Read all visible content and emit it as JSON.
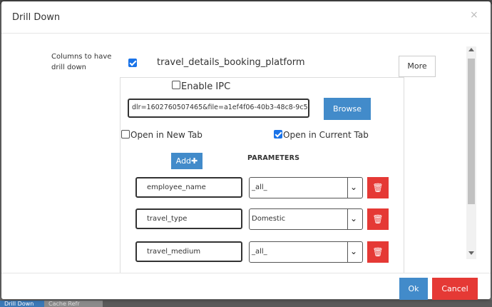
{
  "backdrop": {
    "tab_active": "Drill Down",
    "tab_second": "Cache Refr"
  },
  "modal": {
    "title": "Drill Down",
    "close_glyph": "×"
  },
  "drill": {
    "columns_label": "Columns to have drill down",
    "field_checked": true,
    "field_name": "travel_details_booking_platform",
    "more_label": "More"
  },
  "ipc": {
    "label": "Enable IPC",
    "checked": false
  },
  "url": {
    "value": "dlr=1602760507465&file=a1ef4f06-40b3-48c8-9c5"
  },
  "browse_label": "Browse",
  "open_options": {
    "new_tab_label": "Open in New Tab",
    "new_tab_checked": false,
    "current_tab_label": "Open in Current Tab",
    "current_tab_checked": true
  },
  "add_label": "Add",
  "add_icon": "plus-icon",
  "parameters_label": "PARAMETERS",
  "params": [
    {
      "name": "employee_name",
      "value": "_all_"
    },
    {
      "name": "travel_type",
      "value": "Domestic"
    },
    {
      "name": "travel_medium",
      "value": "_all_"
    }
  ],
  "footer": {
    "ok_label": "Ok",
    "cancel_label": "Cancel"
  },
  "colors": {
    "primary": "#428bca",
    "danger": "#e53935",
    "checkbox": "#1a73e8"
  }
}
